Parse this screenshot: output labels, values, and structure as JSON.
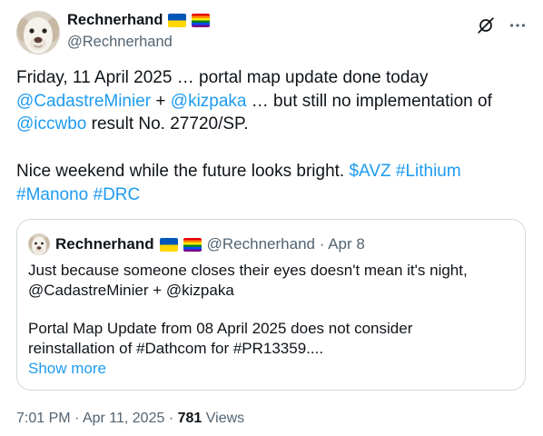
{
  "tweet": {
    "author": {
      "name": "Rechnerhand",
      "handle": "@Rechnerhand",
      "badges": [
        "ukraine-flag-icon",
        "rainbow-flag-icon"
      ]
    },
    "icons": {
      "grok": "grok-icon",
      "more": "more-dots-icon"
    },
    "paragraphs": [
      [
        {
          "t": "Friday, 11 April 2025 … portal map update done today ",
          "link": false
        },
        {
          "t": "@CadastreMinier",
          "link": true
        },
        {
          "t": " + ",
          "link": false
        },
        {
          "t": "@kizpaka",
          "link": true
        },
        {
          "t": " … but still no implementation of ",
          "link": false
        },
        {
          "t": "@iccwbo",
          "link": true
        },
        {
          "t": " result No. 27720/SP.",
          "link": false
        }
      ],
      [
        {
          "t": "Nice weekend while the future looks bright. ",
          "link": false
        },
        {
          "t": "$AVZ",
          "link": true
        },
        {
          "t": " ",
          "link": false
        },
        {
          "t": "#Lithium",
          "link": true
        },
        {
          "t": " ",
          "link": false
        },
        {
          "t": "#Manono",
          "link": true
        },
        {
          "t": " ",
          "link": false
        },
        {
          "t": "#DRC",
          "link": true
        }
      ]
    ],
    "quoted": {
      "author": {
        "name": "Rechnerhand",
        "handle": "@Rechnerhand",
        "separator": "·",
        "date": "Apr 8",
        "badges": [
          "ukraine-flag-icon",
          "rainbow-flag-icon"
        ]
      },
      "paragraphs": [
        "Just because someone closes their eyes doesn't mean it's night, @CadastreMinier + @kizpaka",
        "Portal Map Update from 08 April 2025 does not consider reinstallation of #Dathcom for #PR13359...."
      ],
      "show_more": "Show more"
    },
    "footer": {
      "time": "7:01 PM",
      "separator": "·",
      "date": "Apr 11, 2025",
      "views_count": "781",
      "views_label": "Views"
    }
  },
  "colors": {
    "text": "#0f1419",
    "secondary_text": "#536471",
    "link": "#1d9bf0",
    "card_border": "#cfd9de",
    "background": "#ffffff"
  }
}
